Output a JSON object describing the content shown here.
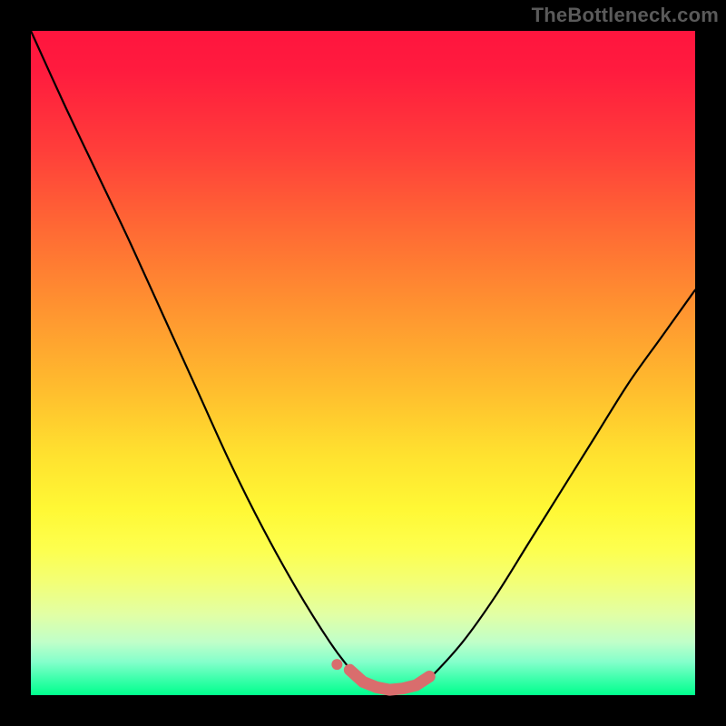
{
  "watermark": "TheBottleneck.com",
  "colors": {
    "frame": "#000000",
    "curve_stroke": "#000000",
    "marker_stroke": "#d96d6d",
    "marker_fill": "#d96d6d"
  },
  "chart_data": {
    "type": "line",
    "title": "",
    "xlabel": "",
    "ylabel": "",
    "xlim": [
      0,
      100
    ],
    "ylim": [
      0,
      100
    ],
    "series": [
      {
        "name": "bottleneck-curve",
        "x": [
          0,
          5,
          10,
          15,
          20,
          25,
          30,
          35,
          40,
          45,
          48,
          50,
          52,
          55,
          58,
          60,
          65,
          70,
          75,
          80,
          85,
          90,
          95,
          100
        ],
        "y": [
          100,
          89,
          78.5,
          68,
          57,
          46,
          35,
          25,
          16,
          8,
          4,
          2,
          1,
          0.5,
          1,
          2.5,
          8,
          15,
          23,
          31,
          39,
          47,
          54,
          61
        ]
      }
    ],
    "markers": {
      "name": "optimal-range",
      "x": [
        48,
        50,
        52,
        54,
        56,
        58,
        60
      ],
      "y": [
        3.8,
        2.0,
        1.2,
        0.8,
        1.0,
        1.5,
        2.8
      ]
    }
  }
}
